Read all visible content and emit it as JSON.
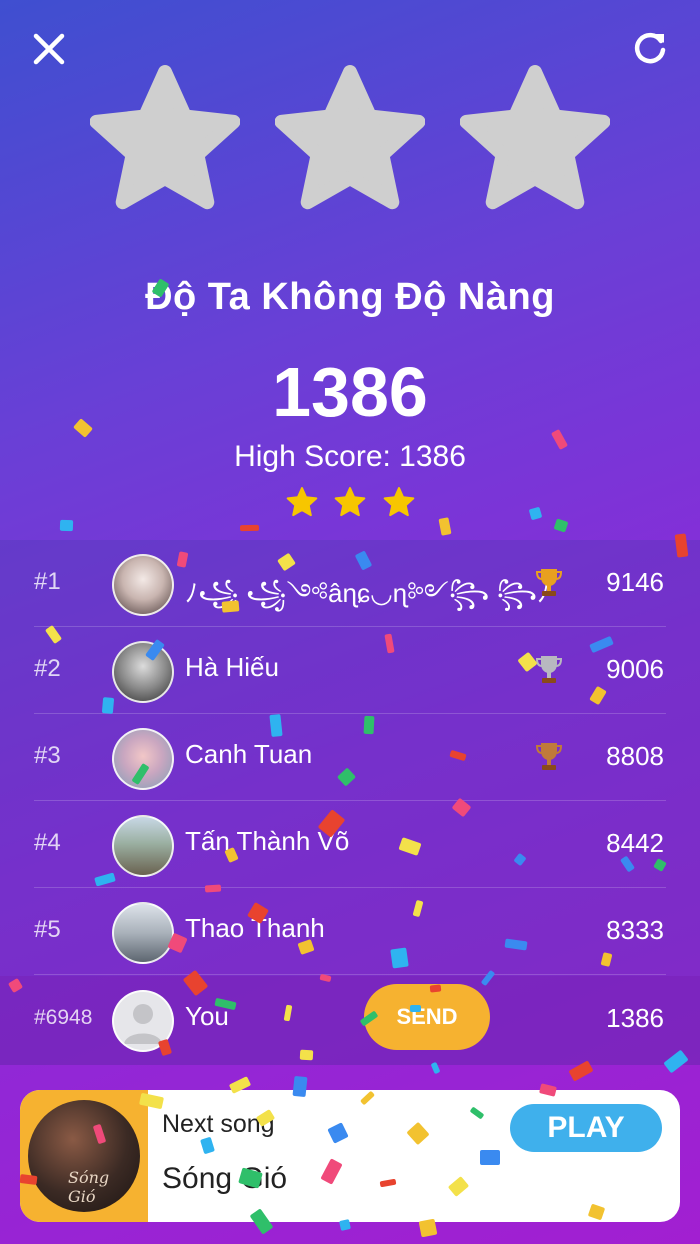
{
  "header": {
    "close_icon": "close-icon",
    "replay_icon": "replay-icon"
  },
  "result": {
    "stars_earned": 0,
    "stars_total": 3,
    "song_title": "Độ Ta Không Độ Nàng",
    "score": "1386",
    "high_score": "High Score: 1386",
    "small_stars_earned": 3
  },
  "leaderboard": {
    "rows": [
      {
        "rank": "#1",
        "name": "ﾉ꧁ ꧁༺âɳɕ◡ɳ༻꧂ ꧂ﾉ",
        "score": "9146",
        "trophy": "gold"
      },
      {
        "rank": "#2",
        "name": "Hà Hiếu",
        "score": "9006",
        "trophy": "silver"
      },
      {
        "rank": "#3",
        "name": "Canh Tuan",
        "score": "8808",
        "trophy": "bronze"
      },
      {
        "rank": "#4",
        "name": "Tấn Thành Võ",
        "score": "8442",
        "trophy": ""
      },
      {
        "rank": "#5",
        "name": "Thao Thanh",
        "score": "8333",
        "trophy": ""
      }
    ],
    "you": {
      "rank": "#6948",
      "name": "You",
      "score": "1386",
      "send_label": "SEND"
    }
  },
  "next_song": {
    "label": "Next song",
    "title": "Sóng Gió",
    "cover_text": "Sóng Gió",
    "play_label": "PLAY"
  },
  "colors": {
    "accent_orange": "#f6b230",
    "play_blue": "#3fb0ec",
    "star_gold": "#f7c600",
    "star_empty": "#cfcfcf"
  }
}
